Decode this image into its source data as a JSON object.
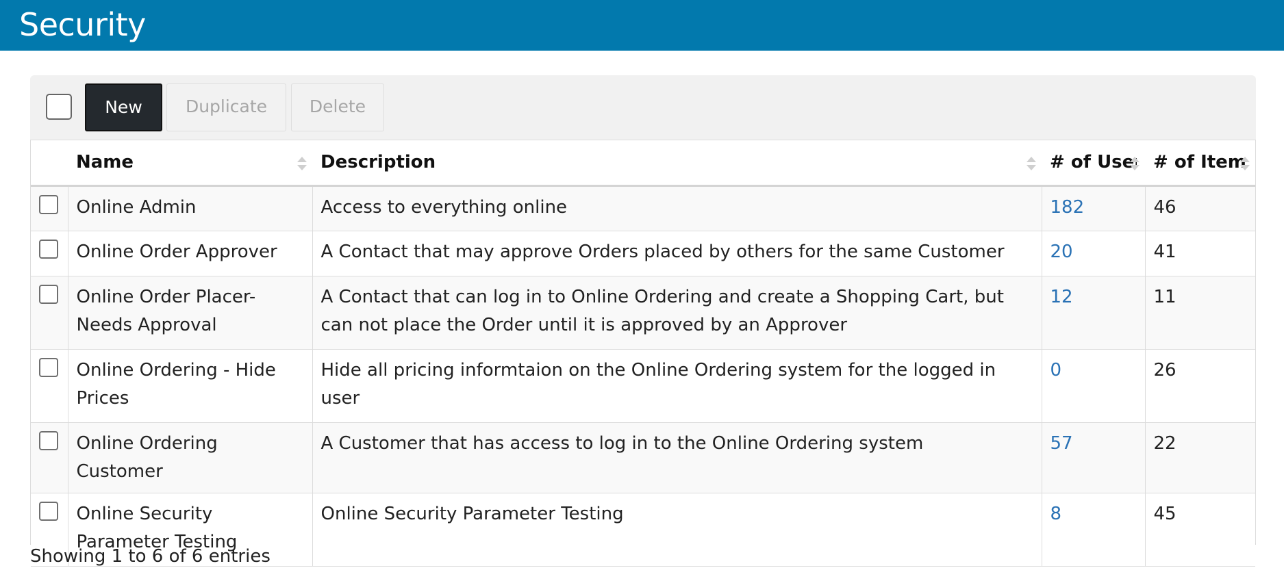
{
  "header": {
    "title": "Security"
  },
  "toolbar": {
    "new_label": "New",
    "duplicate_label": "Duplicate",
    "delete_label": "Delete"
  },
  "table": {
    "columns": {
      "name": "Name",
      "description": "Description",
      "users": "# of Users",
      "items": "# of Items"
    },
    "rows": [
      {
        "name": "Online Admin",
        "description": "Access to everything online",
        "users": "182",
        "items": "46"
      },
      {
        "name": "Online Order Approver",
        "description": "A Contact that may approve Orders placed by others for the same Customer",
        "users": "20",
        "items": "41"
      },
      {
        "name": "Online Order Placer-Needs Approval",
        "description": "A Contact that can log in to Online Ordering and create a Shopping Cart, but can not place the Order until it is approved by an Approver",
        "users": "12",
        "items": "11"
      },
      {
        "name": "Online Ordering - Hide Prices",
        "description": "Hide all pricing informtaion on the Online Ordering system for the logged in user",
        "users": "0",
        "items": "26"
      },
      {
        "name": "Online Ordering Customer",
        "description": "A Customer that has access to log in to the Online Ordering system",
        "users": "57",
        "items": "22"
      },
      {
        "name": "Online Security Parameter Testing",
        "description": "Online Security Parameter Testing",
        "users": "8",
        "items": "45"
      }
    ]
  },
  "footer": {
    "info": "Showing 1 to 6 of 6 entries"
  },
  "colors": {
    "header_bg": "#0279ad",
    "primary_button": "#24292e",
    "link": "#2a72b5"
  }
}
